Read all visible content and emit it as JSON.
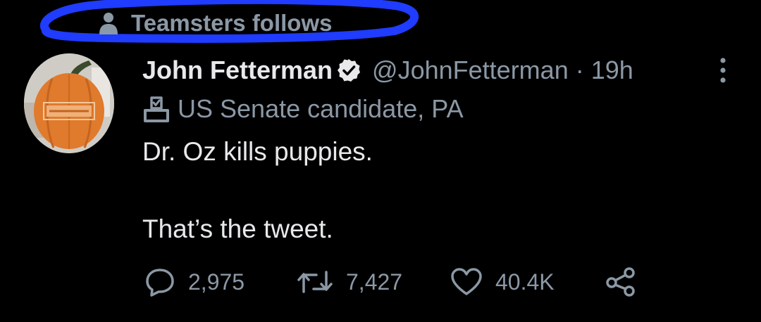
{
  "social_context": {
    "text": "Teamsters follows",
    "icon": "person-icon"
  },
  "tweet": {
    "author": {
      "display_name": "John Fetterman",
      "handle": "@JohnFetterman",
      "verified": true,
      "avatar": "pumpkin-avatar"
    },
    "separator": "·",
    "time": "19h",
    "label": {
      "icon": "ballot-box-icon",
      "text": "US Senate candidate, PA"
    },
    "text_lines": [
      "Dr. Oz kills puppies.",
      "That’s the tweet."
    ],
    "metrics": {
      "replies": "2,975",
      "retweets": "7,427",
      "likes": "40.4K"
    }
  },
  "colors": {
    "background": "#000000",
    "primary_text": "#e7e9ea",
    "secondary_text": "#8b98a5",
    "annotation": "#1f3cff"
  }
}
